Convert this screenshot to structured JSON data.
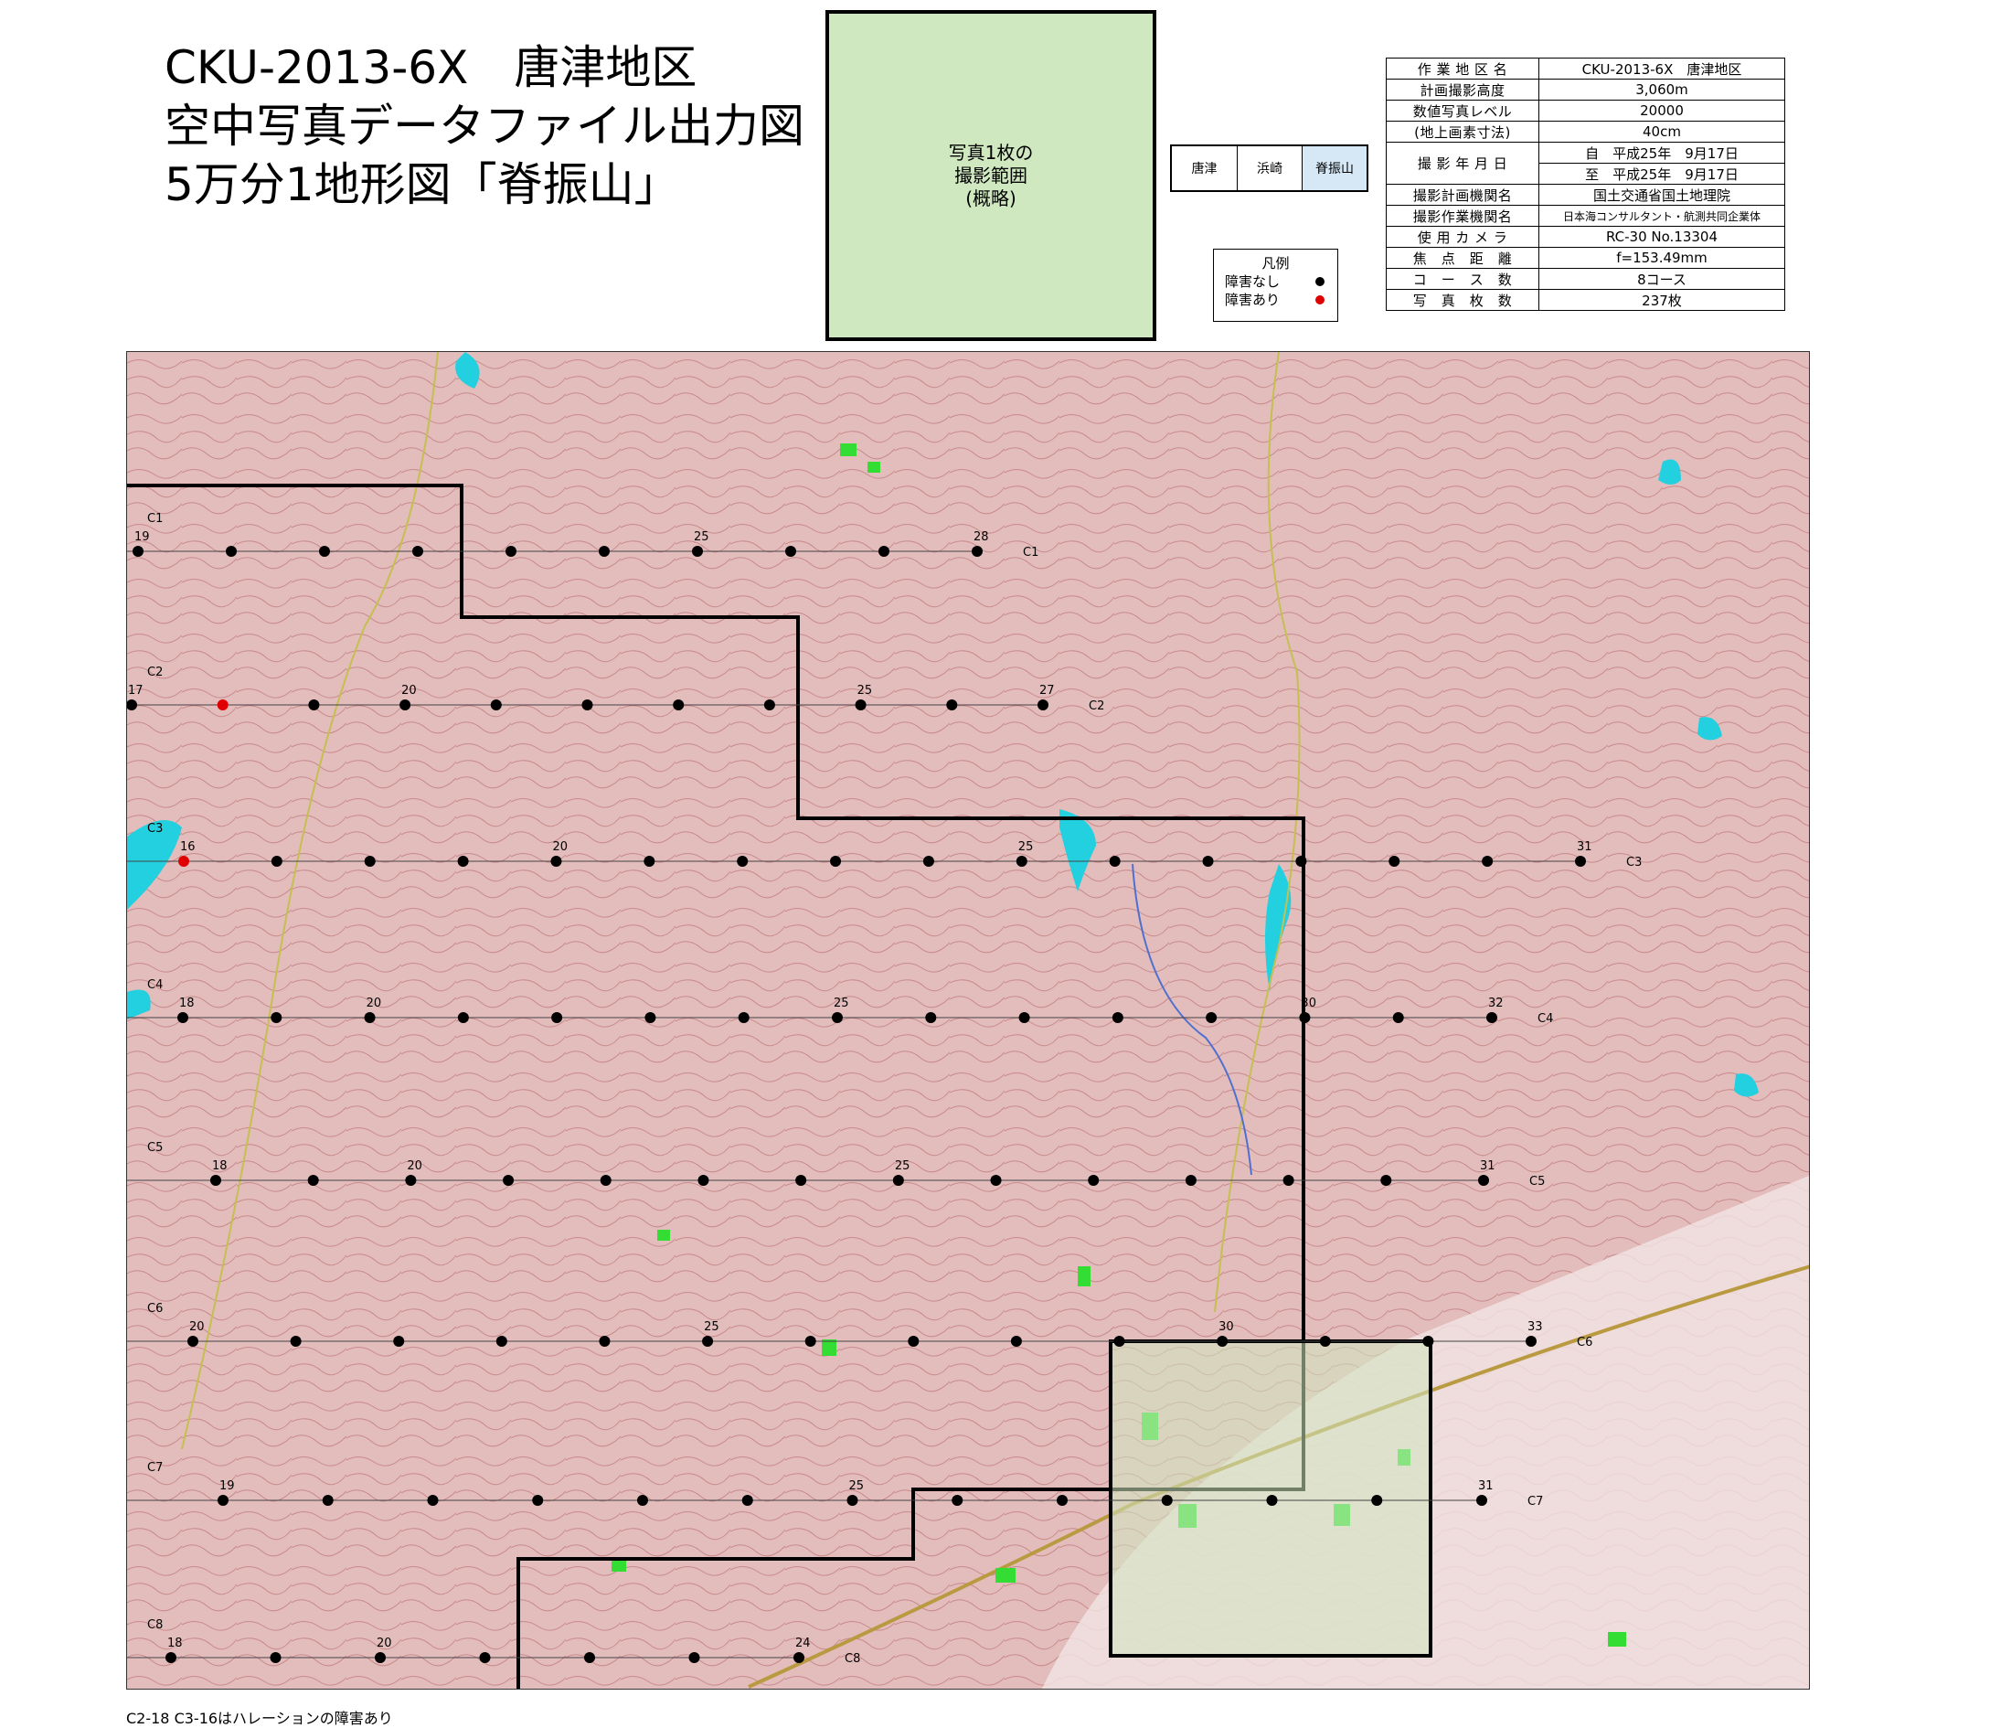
{
  "title": {
    "line1": "CKU-2013-6X　唐津地区",
    "line2": "空中写真データファイル出力図",
    "line3": "5万分1地形図「脊振山」"
  },
  "photo_coverage": {
    "line1": "写真1枚の",
    "line2": "撮影範囲",
    "line3": "(概略)"
  },
  "index_map": [
    "唐津",
    "浜崎",
    "脊振山"
  ],
  "legend": {
    "title": "凡例",
    "items": [
      {
        "label": "障害なし",
        "color": "#000000"
      },
      {
        "label": "障害あり",
        "color": "#e00000"
      }
    ]
  },
  "info_table": [
    {
      "key": "作 業 地 区 名",
      "value": "CKU-2013-6X　唐津地区"
    },
    {
      "key": "計画撮影高度",
      "value": "3,060m"
    },
    {
      "key": "数値写真レベル",
      "value": "20000"
    },
    {
      "key": "(地上画素寸法)",
      "value": "40cm"
    },
    {
      "key": "撮 影 年 月 日",
      "value": "自　平成25年　9月17日",
      "value2": "至　平成25年　9月17日"
    },
    {
      "key": "撮影計画機関名",
      "value": "国土交通省国土地理院"
    },
    {
      "key": "撮影作業機関名",
      "value": "日本海コンサルタント・航測共同企業体"
    },
    {
      "key": "使 用 カ メ ラ",
      "value": "RC-30 No.13304"
    },
    {
      "key": "焦　点　距　離",
      "value": "f=153.49mm"
    },
    {
      "key": "コ　ー　ス　数",
      "value": "8コース"
    },
    {
      "key": "写　真　枚　数",
      "value": "237枚"
    }
  ],
  "map": {
    "courses": [
      {
        "name": "C1",
        "first": 19,
        "last": 28,
        "labeled": [
          19,
          25,
          28
        ],
        "obstruction": []
      },
      {
        "name": "C2",
        "first": 17,
        "last": 27,
        "labeled": [
          17,
          20,
          25,
          27
        ],
        "obstruction": [
          18
        ]
      },
      {
        "name": "C3",
        "first": 16,
        "last": 31,
        "labeled": [
          16,
          20,
          25,
          31
        ],
        "obstruction": [
          16
        ]
      },
      {
        "name": "C4",
        "first": 18,
        "last": 32,
        "labeled": [
          18,
          20,
          25,
          30,
          32
        ],
        "obstruction": []
      },
      {
        "name": "C5",
        "first": 18,
        "last": 31,
        "labeled": [
          18,
          20,
          25,
          31
        ],
        "obstruction": []
      },
      {
        "name": "C6",
        "first": 20,
        "last": 33,
        "labeled": [
          20,
          25,
          30,
          33
        ],
        "obstruction": []
      },
      {
        "name": "C7",
        "first": 19,
        "last": 31,
        "labeled": [
          19,
          25,
          31
        ],
        "obstruction": []
      },
      {
        "name": "C8",
        "first": 18,
        "last": 24,
        "labeled": [
          18,
          20,
          24
        ],
        "obstruction": []
      }
    ]
  },
  "footnote": "C2-18 C3-16はハレーションの障害あり",
  "colors": {
    "coverage_fill": "#cfe8c0",
    "terrain": "#e3bcbc",
    "water": "#22d0e0",
    "forest": "#33dd33",
    "normal_point": "#000000",
    "obstruction_point": "#e00000"
  }
}
